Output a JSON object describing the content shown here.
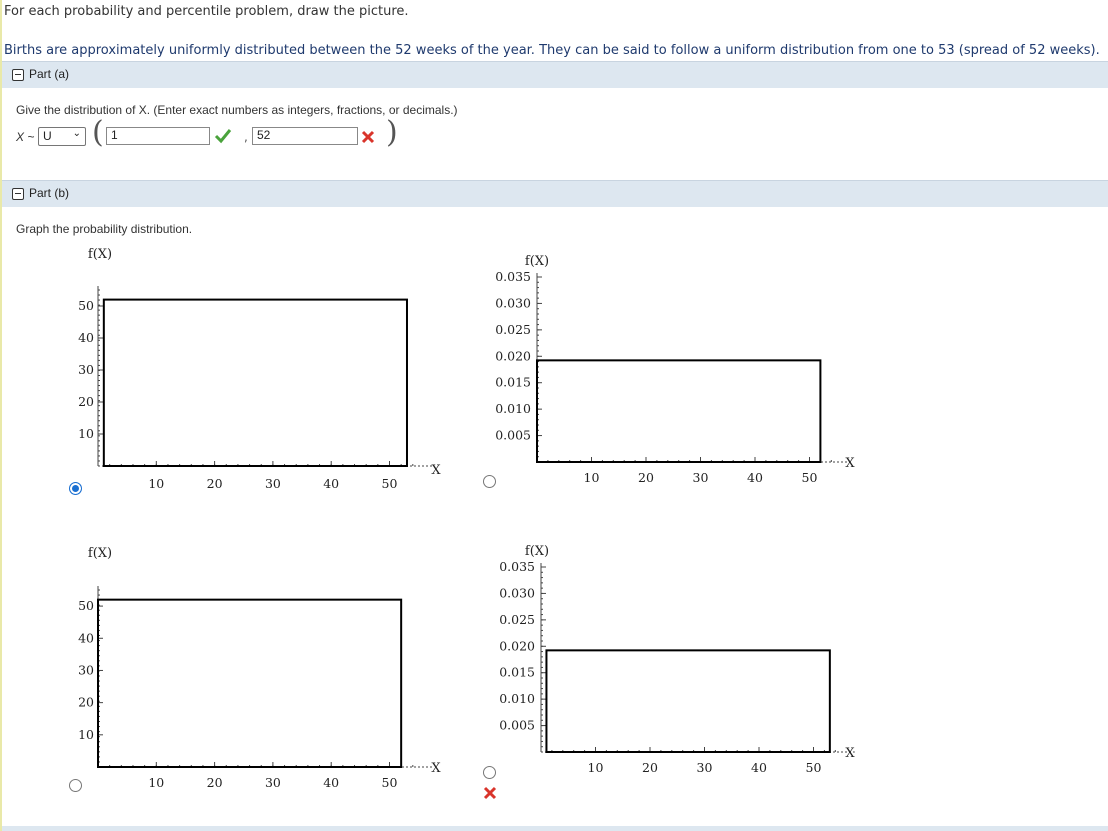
{
  "intro": {
    "instruction": "For each probability and percentile problem, draw the picture.",
    "problem": "Births are approximately uniformly distributed between the 52 weeks of the year. They can be said to follow a uniform distribution from one to 53 (spread of 52 weeks)."
  },
  "part_a": {
    "label": "Part (a)",
    "question": "Give the distribution of X. (Enter exact numbers as integers, fractions, or decimals.)",
    "x_label": "X ~",
    "dist_select": "U",
    "param1": "1",
    "param1_status": "correct",
    "comma": ",",
    "param2": "52",
    "param2_status": "incorrect"
  },
  "part_b": {
    "label": "Part (b)",
    "question": "Graph the probability distribution.",
    "selected_option": 0,
    "result_mark": "incorrect"
  },
  "chart_data": [
    {
      "type": "area",
      "ylabel": "f(X)",
      "xlabel": "X",
      "xticks": [
        "10",
        "20",
        "30",
        "40",
        "50"
      ],
      "yticks": [
        "10",
        "20",
        "30",
        "40",
        "50"
      ],
      "xlim": [
        0,
        55
      ],
      "ylim": [
        0,
        55
      ],
      "rect": {
        "x0": 1,
        "x1": 53,
        "y": 52
      }
    },
    {
      "type": "area",
      "ylabel": "f(X)",
      "xlabel": "X",
      "xticks": [
        "10",
        "20",
        "30",
        "40",
        "50"
      ],
      "yticks": [
        "0.005",
        "0.010",
        "0.015",
        "0.020",
        "0.025",
        "0.030",
        "0.035"
      ],
      "xlim": [
        0,
        55
      ],
      "ylim": [
        0,
        0.035
      ],
      "rect": {
        "x0": 0,
        "x1": 52,
        "y": 0.01923
      }
    },
    {
      "type": "area",
      "ylabel": "f(X)",
      "xlabel": "X",
      "xticks": [
        "10",
        "20",
        "30",
        "40",
        "50"
      ],
      "yticks": [
        "10",
        "20",
        "30",
        "40",
        "50"
      ],
      "xlim": [
        0,
        55
      ],
      "ylim": [
        0,
        55
      ],
      "rect": {
        "x0": 0,
        "x1": 52,
        "y": 52
      }
    },
    {
      "type": "area",
      "ylabel": "f(X)",
      "xlabel": "X",
      "xticks": [
        "10",
        "20",
        "30",
        "40",
        "50"
      ],
      "yticks": [
        "0.005",
        "0.010",
        "0.015",
        "0.020",
        "0.025",
        "0.030",
        "0.035"
      ],
      "xlim": [
        0,
        55
      ],
      "ylim": [
        0,
        0.035
      ],
      "rect": {
        "x0": 1,
        "x1": 53,
        "y": 0.01923
      }
    }
  ]
}
